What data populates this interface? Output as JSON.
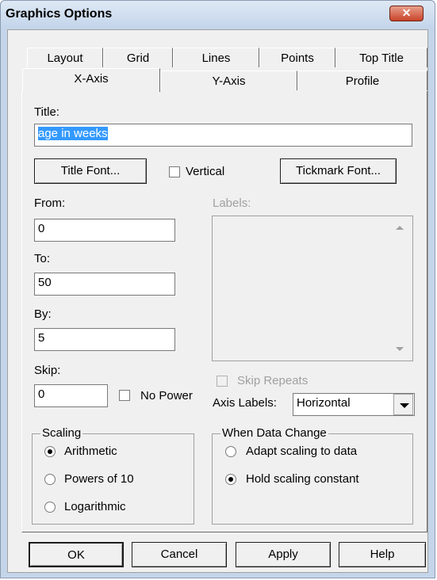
{
  "window": {
    "title": "Graphics Options",
    "close_label": "✕"
  },
  "tabs_row1": [
    "Layout",
    "Grid",
    "Lines",
    "Points",
    "Top Title"
  ],
  "tabs_row2": [
    "X-Axis",
    "Y-Axis",
    "Profile"
  ],
  "active_tab": "X-Axis",
  "axis": {
    "title_label": "Title:",
    "title_value": "age in weeks",
    "title_font_button": "Title Font...",
    "vertical_label": "Vertical",
    "vertical_checked": false,
    "tickmark_font_button": "Tickmark Font...",
    "from_label": "From:",
    "from_value": "0",
    "to_label": "To:",
    "to_value": "50",
    "by_label": "By:",
    "by_value": "5",
    "skip_label": "Skip:",
    "skip_value": "0",
    "no_power_label": "No Power",
    "no_power_checked": false,
    "labels_label": "Labels:",
    "skip_repeats_label": "Skip Repeats",
    "axis_labels_label": "Axis Labels:",
    "axis_labels_value": "Horizontal"
  },
  "scaling": {
    "legend": "Scaling",
    "options": [
      "Arithmetic",
      "Powers of 10",
      "Logarithmic"
    ],
    "selected": "Arithmetic"
  },
  "data_change": {
    "legend": "When Data Change",
    "options": [
      "Adapt scaling to data",
      "Hold scaling constant"
    ],
    "selected": "Hold scaling constant"
  },
  "buttons": {
    "ok": "OK",
    "cancel": "Cancel",
    "apply": "Apply",
    "help": "Help"
  },
  "colors": {
    "selection": "#3399ff",
    "titlebar": "#c4d5ea",
    "close": "#c9432a"
  }
}
